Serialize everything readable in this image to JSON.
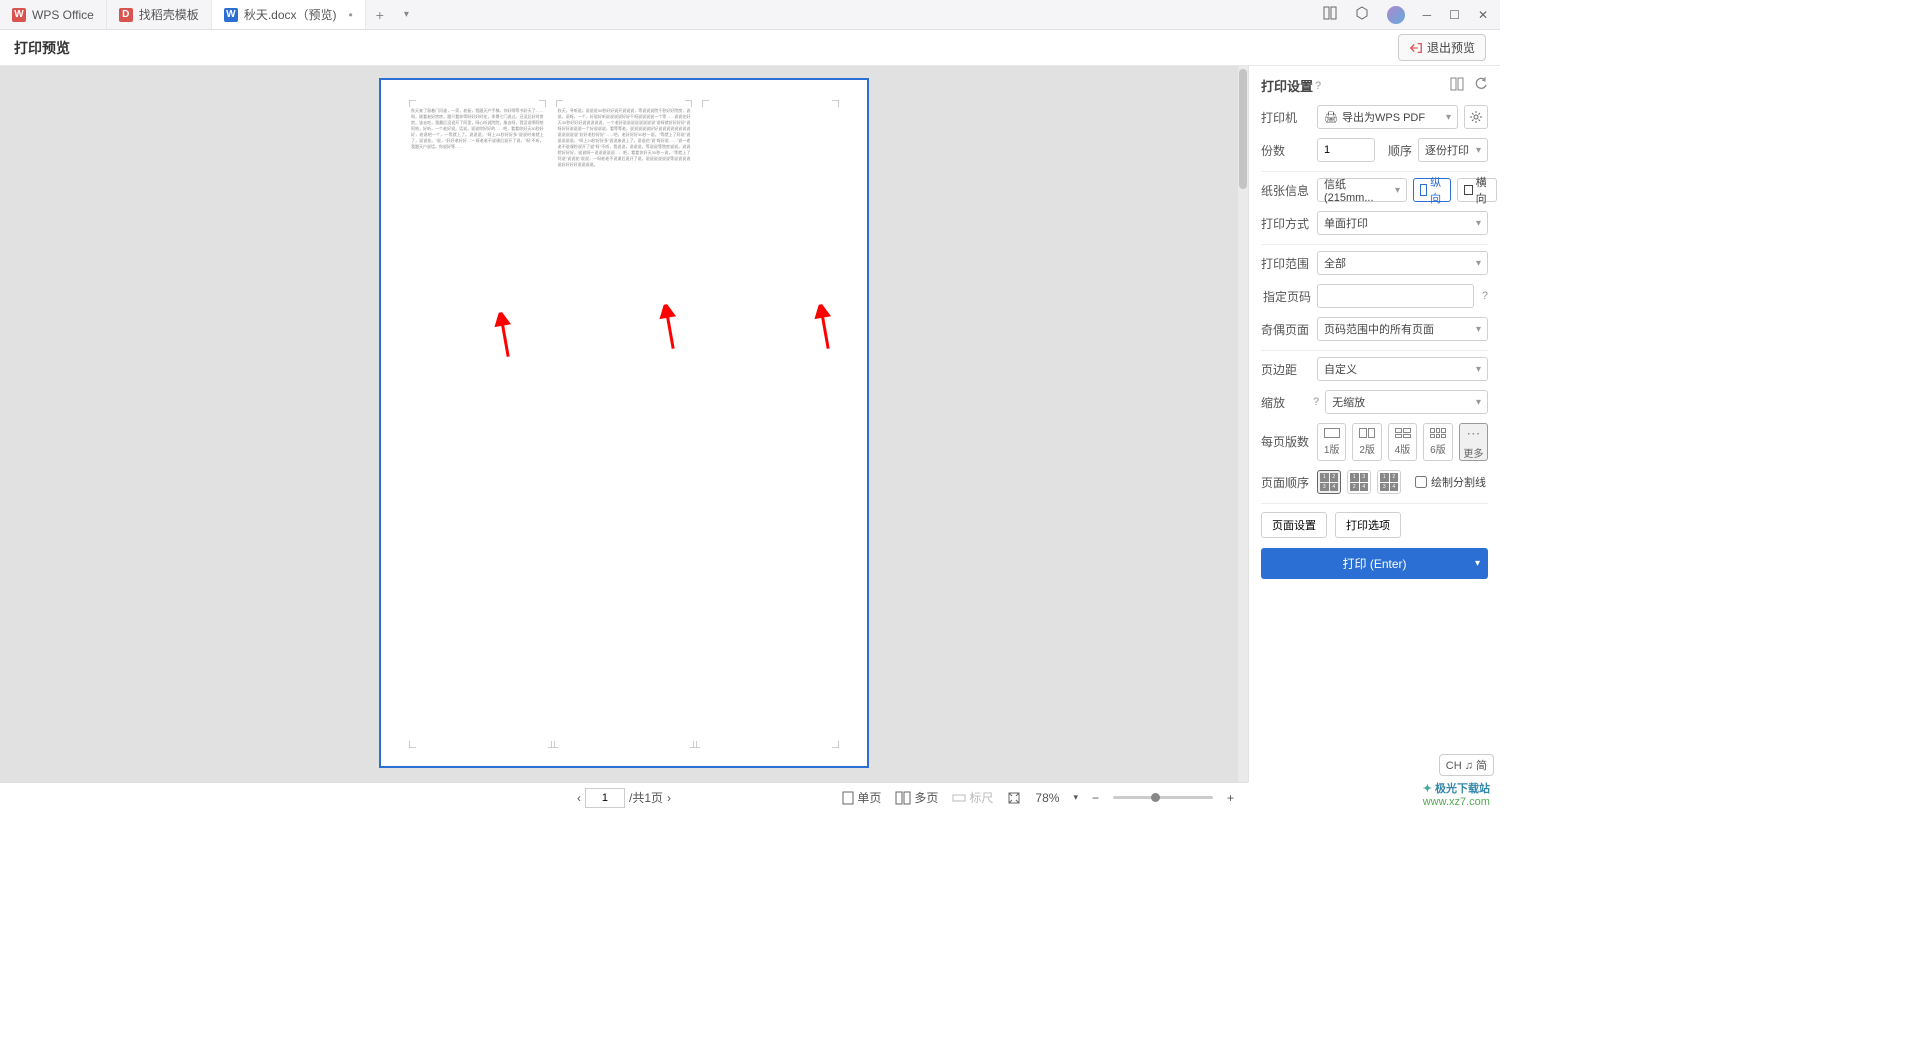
{
  "tabs": {
    "t0": "WPS Office",
    "t1": "找稻壳模板",
    "t2": "秋天.docx（预览)",
    "t2_dirty": "•"
  },
  "toolbar": {
    "title": "打印预览",
    "exit": "退出预览"
  },
  "panel": {
    "title": "打印设置",
    "printer_lbl": "打印机",
    "printer_val": "导出为WPS PDF",
    "copies_lbl": "份数",
    "copies_val": "1",
    "order_lbl": "顺序",
    "order_val": "逐份打印",
    "paper_lbl": "纸张信息",
    "paper_val": "信纸(215mm...",
    "portrait": "纵向",
    "landscape": "横向",
    "method_lbl": "打印方式",
    "method_val": "单面打印",
    "range_lbl": "打印范围",
    "range_val": "全部",
    "pages_lbl": "指定页码",
    "parity_lbl": "奇偶页面",
    "parity_val": "页码范围中的所有页面",
    "margin_lbl": "页边距",
    "margin_val": "自定义",
    "zoom_lbl": "缩放",
    "zoom_val": "无缩放",
    "perpage_lbl": "每页版数",
    "l1": "1版",
    "l2": "2版",
    "l4": "4版",
    "l6": "6版",
    "lmore": "更多",
    "seq_lbl": "页面顺序",
    "divider_chk": "绘制分割线",
    "page_setup": "页面设置",
    "print_opt": "打印选项",
    "print_btn": "打印 (Enter)"
  },
  "status": {
    "page_current": "1",
    "page_total": "/共1页",
    "single": "单页",
    "multi": "多页",
    "ruler": "标尺",
    "zoom_pct": "78%"
  },
  "lang_badge": "CH ♫ 简",
  "watermark": {
    "a": "极光下载站",
    "b": "www.xz7.com"
  }
}
